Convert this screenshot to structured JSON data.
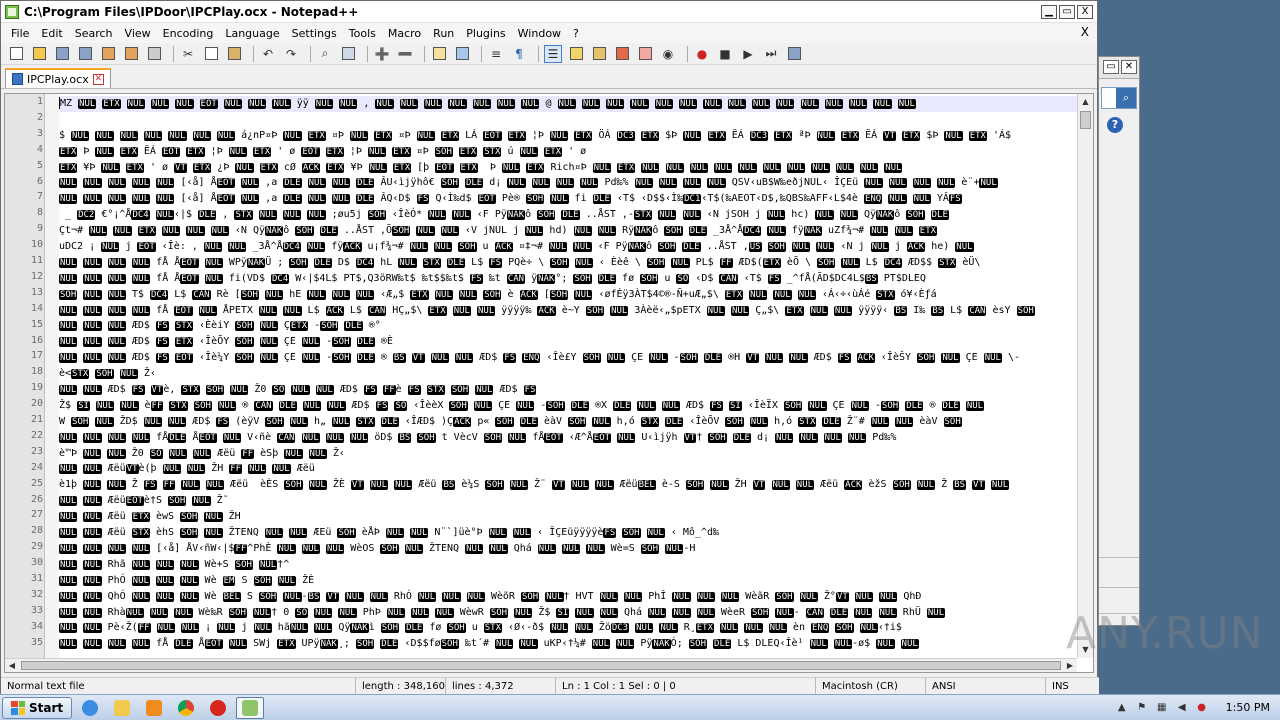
{
  "window": {
    "title": "C:\\Program Files\\IPDoor\\IPCPlay.ocx - Notepad++",
    "close_glyph": "X"
  },
  "menubar": {
    "items": [
      "File",
      "Edit",
      "Search",
      "View",
      "Encoding",
      "Language",
      "Settings",
      "Tools",
      "Macro",
      "Run",
      "Plugins",
      "Window",
      "?"
    ],
    "close_label": "X"
  },
  "tabs": [
    {
      "label": "IPCPlay.ocx",
      "active": true
    }
  ],
  "editor": {
    "line_numbers": [
      "1",
      "2",
      "3",
      "4",
      "5",
      "6",
      "7",
      "8",
      "9",
      "10",
      "11",
      "12",
      "13",
      "14",
      "15",
      "16",
      "17",
      "18",
      "19",
      "20",
      "21",
      "22",
      "23",
      "24",
      "25",
      "26",
      "27",
      "28",
      "29",
      "30",
      "31",
      "32",
      "33",
      "34",
      "35"
    ],
    "lines": [
      "MZ NUL ETX NUL NUL NUL EOT NUL NUL NUL ÿÿ NUL NUL , NUL NUL NUL NUL NUL NUL NUL @ NUL NUL NUL NUL NUL NUL NUL NUL NUL NUL NUL NUL NUL NUL NUL",
      "",
      "$ NUL NUL NUL NUL NUL NUL NUL á¿nP¤Þ NUL ETX ¤Þ NUL ETX ¤Þ NUL ETX LÁ EOT ETX ¦Þ NUL ETX ÖÁ DC3 ETX $Þ NUL ETX ËÁ DC3 ETX ªÞ NUL ETX ËÁ VT ETX $Þ NUL ETX 'Á$",
      "ETX Þ NUL ETX ËÁ EOT ETX ¦Þ NUL ETX ' ø EOT ETX ¦Þ NUL ETX ¤Þ SOH ETX STX ú NUL ETX ' ø",
      "ETX ¥Þ NUL ETX ' ø VT ETX ¿Þ NUL ETX cØ ACK ETX ¥Þ NUL ETX [þ EOT ETX  Þ NUL ETX Rich¤Þ NUL ETX NUL NUL NUL NUL NUL NUL NUL NUL NUL NUL NUL",
      "NUL NUL NUL NUL NUL [‹å] ÅEOT NUL ,a DLE NUL NUL DLE ÂU‹ìjÿhô€ SOH DLE d¡ NUL NUL NUL NUL Pd‰% NUL NUL NUL NUL QSV‹uB$W‰eðjNUL‹ ÎÇEü NUL NUL NUL NUL è¨+NUL",
      "NUL NUL NUL NUL NUL [‹å] ÅEOT NUL ,a DLE NUL NUL DLE ÂQ‹D$ FS Q‹Ì‰d$ EOT Pè® SOH NUL fi DLE ‹T$ ‹D$$‹Ì‰DC1‹T$(‰AEOT‹D$,‰QBS‰AFF‹L$4è ENQ NUL NUL YÂFS",
      " _ DC2 €°¡^ÅDC4 NUL‹|$ DLE , STX NUL NUL NUL ;øu5j SOH ‹ÎèÓ* NUL NUL ‹F PÿNAKô SOH DLE ..ÅST ,-STX NUL NUL ‹N jSOH j NUL hc) NUL NUL QÿNAKô SOH DLE",
      "Çt¬# NUL NUL ETX NUL NUL NUL ‹N QÿNAKô SOH DLE ..ÅST ,ÕSOH NUL NUL ‹V jNUL j NUL hd) NUL NUL RÿNAKô SOH DLE _3Å^ÅDC4 NUL fÿNAK uZf¾¬# NUL NUL ETX",
      "uDC2 ¡ NUL j EOT ‹Îè: , NUL NUL _3Å^ÅDC4 NUL fÿACK u¡f¾¬# NUL NUL SOH u ACK ¤‡¬# NUL NUL ‹F PÿNAKô SOH DLE ..ÅST ,US SOH NUL NUL ‹N j NUL j ACK he) NUL",
      "NUL NUL NUL NUL fÅ ÅEOT NUL WPÿNAKÜ ; SOH DLE D$ DC4 hL NUL STX DLE L$ FS PQè÷ \\ SOH NUL ‹ Èèê \\ SOH NUL PL$ FF ÆD$(ETX èÕ \\ SOH NUL L$ DC4 ÆD$$ STX èÜ\\",
      "NUL NUL NUL NUL fÅ ÅEOT NUL fi(VD$ DC4 W‹|$4L$ PT$,Q3öRW‰t$ ‰t$$‰t$ FS ‰t CAN ÿNAK°; SOH DLE fø SOH u SO ‹D$ CAN ‹T$ FS _^fÅ(ÃD$DC4L$BS PT$DLEQ",
      "SOH NUL NUL T$ DC4 L$ CAN Rè [SOH NUL hE NUL NUL NUL ‹Æ„$ ETX NUL NUL SOH è ACK [SOH NUL ‹øfÉÿ3ÀT$4©®-Ñ+uÆ„$\\ ETX NUL NUL NUL ‹Á‹÷‹ùÁé STX ó¥‹Èƒá",
      "NUL NUL NUL NUL fÅ EOT NUL ÅPETX NUL NUL L$ ACK L$ CAN HÇ„$\\ ETX NUL NUL ÿÿÿÿ‰ ACK è~Y SOH NUL 3Àèë‹„$pETX NUL NUL Ç„$\\ ETX NUL NUL ÿÿÿÿ‹ BS I‰ BS L$ CAN èsY SOH",
      "NUL NUL NUL ÆD$ FS STX ‹ÈèiY SOH NUL ÇETX -SOH DLE ®°",
      "NUL NUL NUL ÆD$ FS ETX ‹ÎèÕY SOH NUL ÇE NUL -SOH DLE ®È",
      "NUL NUL NUL ÆD$ FS EOT ‹Îè¼Y SOH NUL ÇE NUL -SOH DLE ® BS VT NUL NUL ÆD$ FS ENQ ‹Îè£Y SOH NUL ÇE NUL -SOH DLE ®H VT NUL NUL ÆD$ FS ACK ‹ÎèŠY SOH NUL ÇE NUL \\-",
      "è<STX SOH NUL Ž‹",
      "NUL NUL ÆD$ FS VTè, STX SOH NUL Ž0 SO NUL NUL ÆD$ FS FFè FS STX SOH NUL ÆD$ FS",
      "Ž$ SI NUL NUL èFF STX SOH NUL ® CAN DLE NUL NUL ÆD$ FS SO ‹ÎèèX SOH NUL ÇE NUL -SOH DLE ®X DLE NUL NUL ÆD$ FS SI ‹ÎèÏX SOH NUL ÇE NUL -SOH DLE ® DLE NUL",
      "W SOH NUL ŽD$ NUL NUL ÆD$ FS (èÿV SOH NUL h„ NUL STX DLE ‹ÎÆD$ )ÇACK p« SOH DLE èàV SOH NUL h,ó STX DLE ‹ÎèÕV SOH NUL h,ó STX DLE Ž¨# NUL NUL èàV SOH",
      "NUL NUL NUL NUL fÅDLE ÅEOT NUL V‹ñè CAN NUL NUL NUL öD$ BS SOH t VècV SOH NUL fÅEOT ‹Æ^ÅEOT NUL U‹ìjÿh VT† SOH DLE d¡ NUL NUL NUL NUL Pd‰%",
      "è™Þ NUL NUL Ž0 SO NUL NUL Æëü FF èSþ NUL NUL Ž‹",
      "NUL NUL ÆëüVTè(þ NUL NUL ŽH FF NUL NUL Æëü",
      "è1þ NUL NUL Ž FS FF NUL NUL Æëü  èÈS SOH NUL ŽÈ VT NUL NUL Æëü BS è¼S SOH NUL Ž¨ VT NUL NUL ÆëüBEL è-S SOH NUL ŽH VT NUL NUL Æëü ACK èžS SOH NUL Ž BS VT NUL",
      "NUL NUL ÆëüEOTè†S SOH NUL Ž˜",
      "NUL NUL Æëü ETX èwS SOH NUL ŽH",
      "NUL NUL Æëü STX èhS SOH NUL ŽTENQ NUL NUL ÆEü SOH èÅÞ NUL NUL N¨`]üè°Þ NUL NUL ‹ ÎÇEüÿÿÿÿèFS SOH NUL ‹ Mô_^d‰",
      "NUL NUL NUL NUL [‹å] ÅV‹ñW‹|$FF^PhÈ NUL NUL NUL WèOS SOH NUL ŽTENQ NUL NUL Qhá NUL NUL NUL Wè=S SOH NUL-H",
      "NUL NUL Rhã NUL NUL NUL Wè+S SOH NUL†^",
      "NUL NUL PhÓ NUL NUL NUL Wè EM S SOH NUL ŽÈ",
      "NUL NUL QhÓ NUL NUL NUL Wè BEL S SOH NUL-BS VT NUL NUL RhÓ NUL NUL NUL WèõR SOH NUL† HVT NUL NUL PhÎ NUL NUL NUL WèãR SOH NUL Ž°VT NUL NUL QhÐ",
      "NUL NUL RhàNUL NUL NUL Wè‰R SOH NUL† 0 SO NUL NUL PhÞ NUL NUL NUL WèwR SOH NUL Ž$ SI NUL NUL Qhá NUL NUL NUL WèeR SOH NUL- CAN DLE NUL NUL RhÜ NUL",
      "NUL NUL Pè‹Ž(FF NUL NUL ¡ NUL j NUL hãNUL NUL QÿNAKì SOH DLE fø SOH u STX ‹Ø‹-ð$ NUL NUL ŽöDC3 NUL NUL R¸ETX NUL NUL NUL èn ENQ SOH NUL‹†i$",
      "NUL NUL NUL NUL fÅ DLE ÅEOT NUL SWj ETX UPÿNAK¸; SOH DLE ‹D$$føSOH ‰t´# NUL NUL uKP‹†¼# NUL NUL PÿNAKÓ; SOH DLE L$ DLEQ‹Îè¹ NUL NUL-ø$ NUL NUL"
    ]
  },
  "statusbar": {
    "type": "Normal text file",
    "length": "length : 348,160",
    "lines": "lines : 4,372",
    "position": "Ln : 1    Col : 1    Sel : 0 | 0",
    "eol": "Macintosh (CR)",
    "encoding": "ANSI",
    "mode": "INS"
  },
  "taskbar": {
    "start_label": "Start",
    "clock": "1:50 PM"
  },
  "watermark": "ANY.RUN"
}
